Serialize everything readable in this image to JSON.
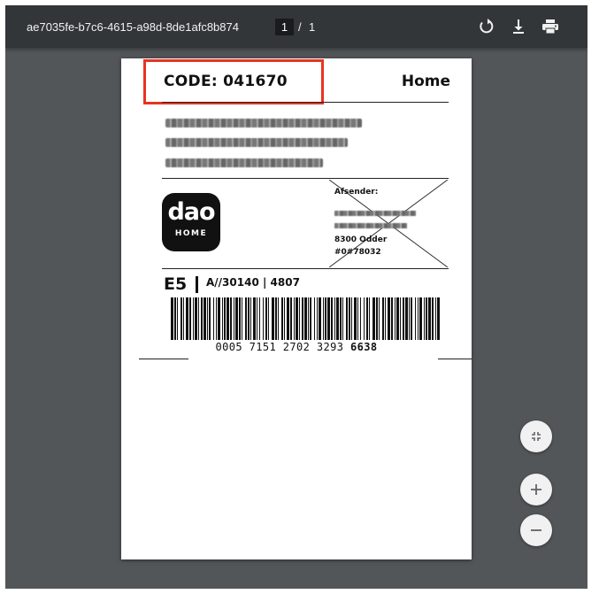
{
  "toolbar": {
    "title": "ae7035fe-b7c6-4615-a98d-8de1afc8b874",
    "page_current": "1",
    "page_separator": "/",
    "page_total": "1",
    "rotate_icon": "rotate-icon",
    "download_icon": "download-icon",
    "print_icon": "print-icon"
  },
  "label": {
    "code": "CODE: 041670",
    "service": "Home",
    "logo_text": "dao",
    "logo_sub": "HOME",
    "sender_label": "Afsender:",
    "sender_city": "8300 Odder",
    "sender_id": "#0#78032",
    "route_es": "E5",
    "route_code": "A//30140 | 4807",
    "barcode_number": "0005 7151 2702 3293",
    "barcode_number_bold": "6638",
    "highlight_color": "#e8331f"
  },
  "controls": {
    "fit_icon": "fit-to-page-icon",
    "zoom_in_icon": "zoom-in-icon",
    "zoom_out_icon": "zoom-out-icon"
  }
}
